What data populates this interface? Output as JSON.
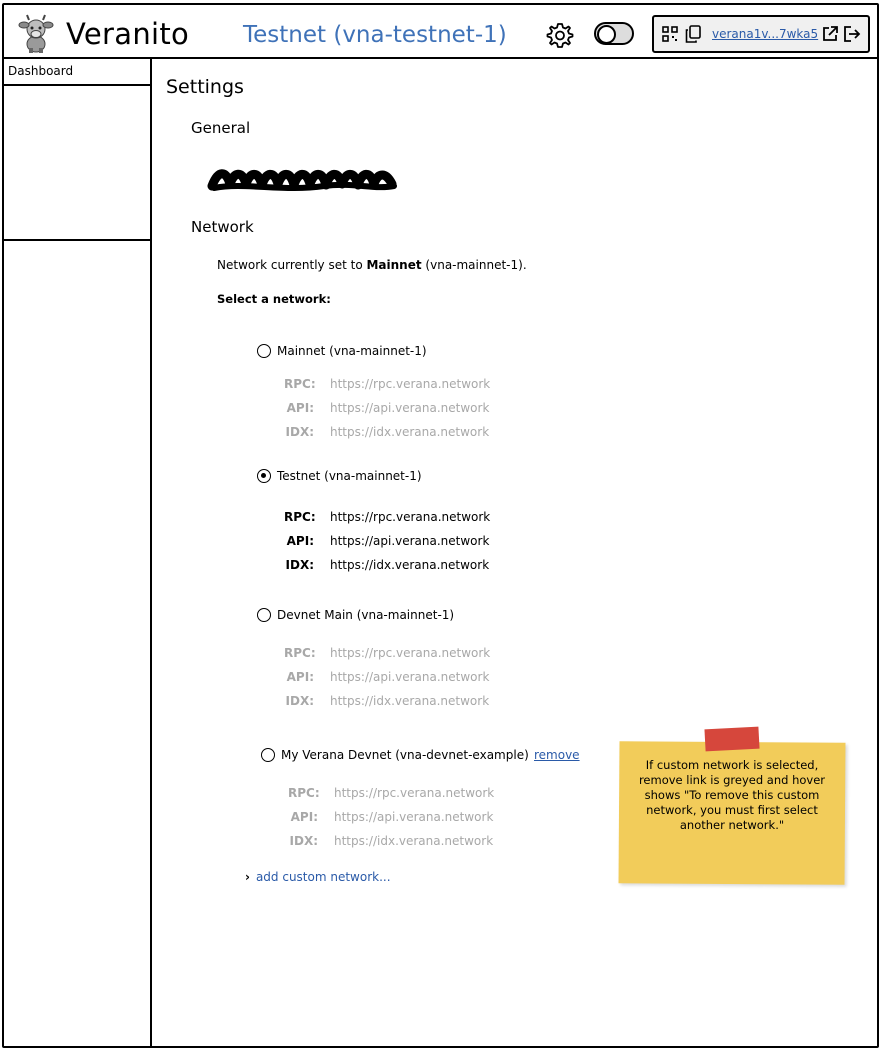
{
  "header": {
    "app_name": "Veranito",
    "network_title": "Testnet (vna-testnet-1)",
    "wallet_address": "verana1v...7wka5"
  },
  "sidebar": {
    "items": [
      {
        "label": "Dashboard"
      }
    ]
  },
  "main": {
    "page_title": "Settings",
    "general_heading": "General",
    "network_heading": "Network",
    "current_prefix": "Network currently set to ",
    "current_name": "Mainnet",
    "current_suffix": " (vna-mainnet-1).",
    "select_label": "Select a network:",
    "networks": [
      {
        "label": "Mainnet (vna-mainnet-1)",
        "selected": false,
        "rpc": "https://rpc.verana.network",
        "api": "https://api.verana.network",
        "idx": "https://idx.verana.network"
      },
      {
        "label": "Testnet (vna-mainnet-1)",
        "selected": true,
        "rpc": "https://rpc.verana.network",
        "api": "https://api.verana.network",
        "idx": "https://idx.verana.network"
      },
      {
        "label": "Devnet Main (vna-mainnet-1)",
        "selected": false,
        "rpc": "https://rpc.verana.network",
        "api": "https://api.verana.network",
        "idx": "https://idx.verana.network"
      },
      {
        "label": "My Verana Devnet (vna-devnet-example)",
        "selected": false,
        "remove_label": "remove",
        "rpc": "https://rpc.verana.network",
        "api": "https://api.verana.network",
        "idx": "https://idx.verana.network"
      }
    ],
    "endpoint_labels": {
      "rpc": "RPC:",
      "api": "API:",
      "idx": "IDX:"
    },
    "add_custom_label": "add custom network..."
  },
  "sticky_note": {
    "text": "If custom network is selected, remove link is greyed and hover shows \"To remove this custom network, you must first select another network.\""
  },
  "colors": {
    "accent_blue": "#3f72b8",
    "link_blue": "#2a5aa8",
    "muted_grey": "#a8a8a8",
    "sticky_yellow": "#f2cc5a",
    "tape_red": "#d6473c"
  }
}
